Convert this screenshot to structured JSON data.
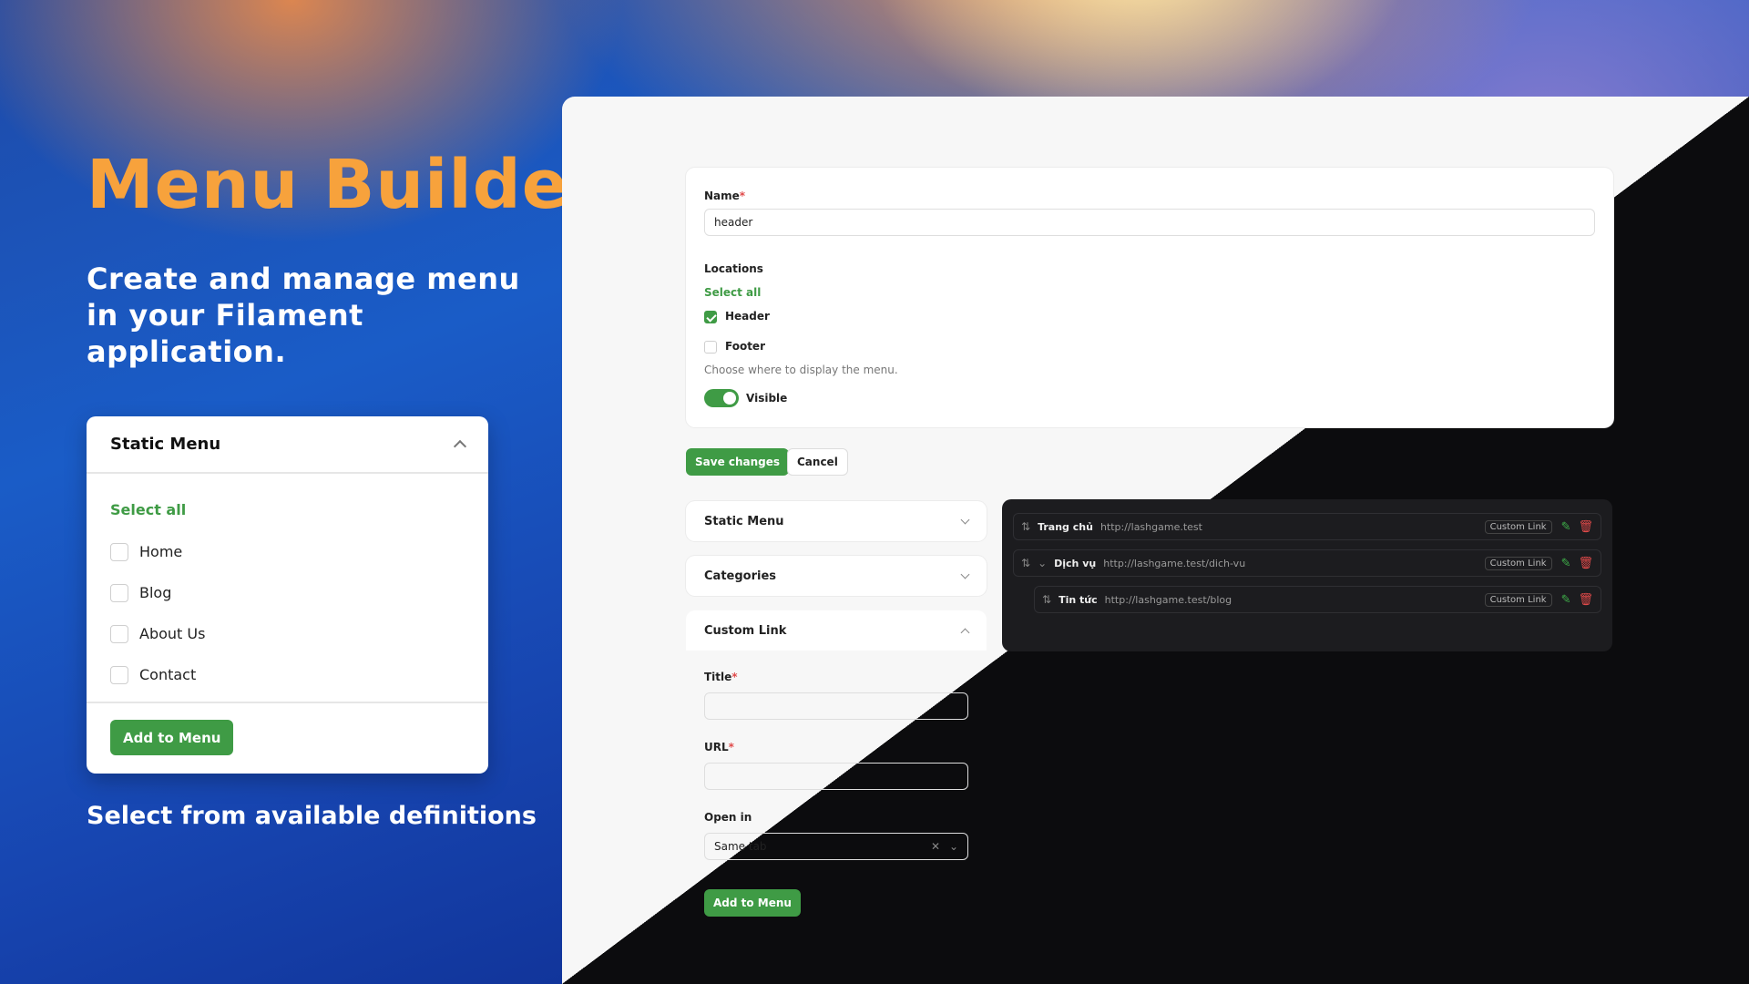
{
  "hero": {
    "title": "Menu Builder",
    "subtitle": "Create and manage menu in your Filament application.",
    "caption": "Select from available definitions"
  },
  "static_card": {
    "title": "Static Menu",
    "select_all": "Select all",
    "items": [
      "Home",
      "Blog",
      "About Us",
      "Contact"
    ],
    "button": "Add to Menu"
  },
  "form": {
    "name_label": "Name",
    "name_value": "header",
    "locations_label": "Locations",
    "select_all": "Select all",
    "locations": [
      {
        "label": "Header",
        "checked": true
      },
      {
        "label": "Footer",
        "checked": false
      }
    ],
    "hint": "Choose where to display the menu.",
    "visible_label": "Visible",
    "visible": true
  },
  "actions": {
    "save": "Save changes",
    "cancel": "Cancel"
  },
  "sections": {
    "static": "Static Menu",
    "categories": "Categories",
    "custom": "Custom Link"
  },
  "custom_link": {
    "title_label": "Title",
    "url_label": "URL",
    "open_label": "Open in",
    "open_value": "Same tab",
    "button": "Add to Menu"
  },
  "tree": [
    {
      "title": "Trang chủ",
      "url": "http://lashgame.test",
      "type": "Custom Link"
    },
    {
      "title": "Dịch vụ",
      "url": "http://lashgame.test/dich-vu",
      "type": "Custom Link"
    },
    {
      "title": "Tin tức",
      "url": "http://lashgame.test/blog",
      "type": "Custom Link"
    }
  ],
  "colors": {
    "accent": "#3f9b45",
    "title": "#f7a23c",
    "danger": "#e04a4a"
  }
}
